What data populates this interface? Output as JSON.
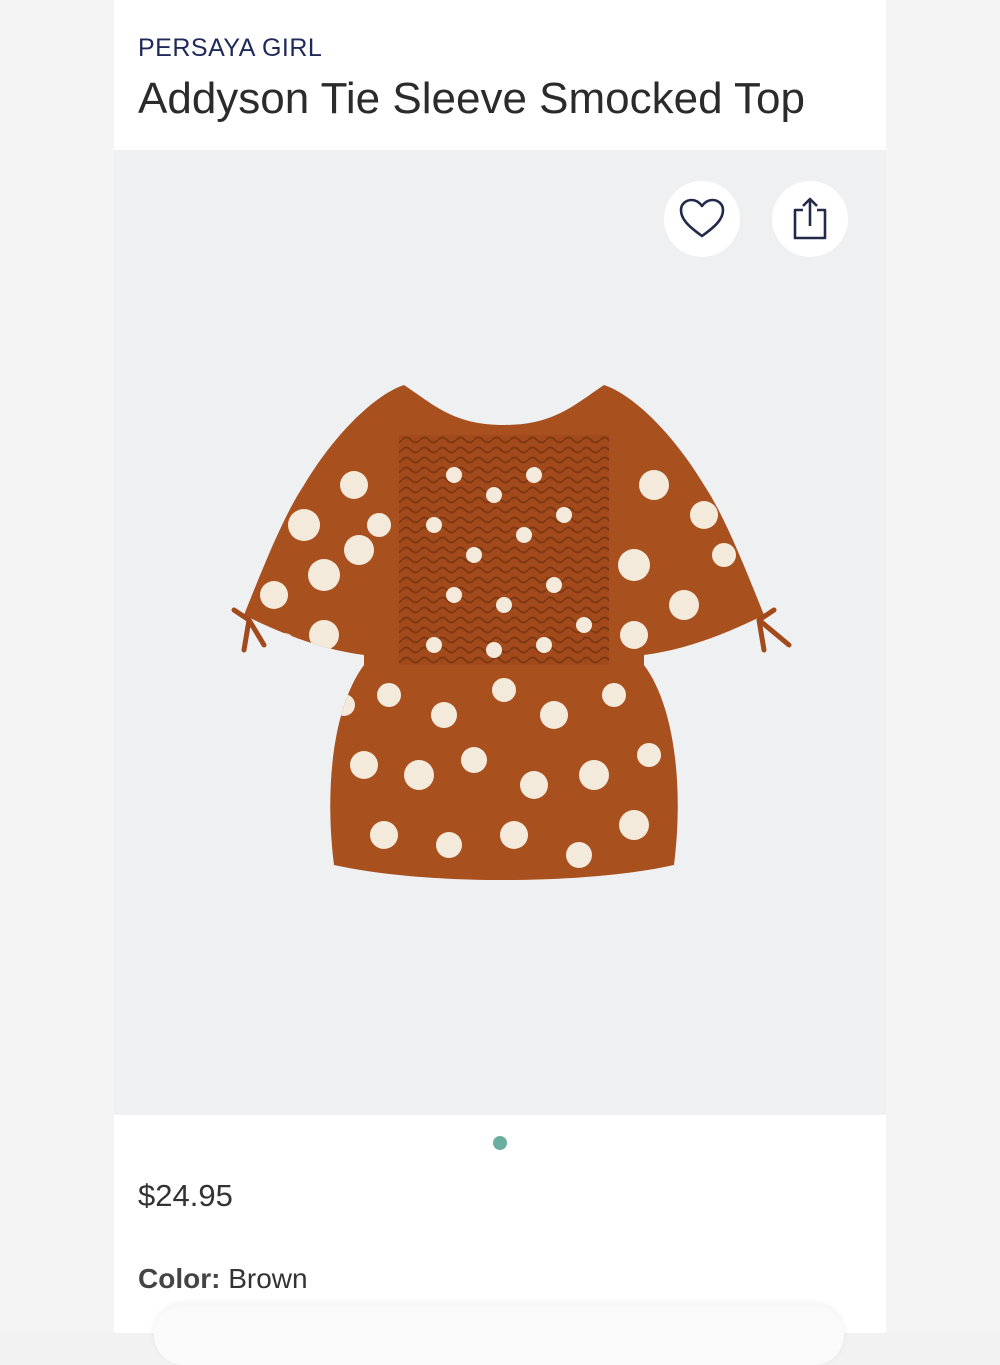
{
  "product": {
    "brand": "PERSAYA GIRL",
    "title": "Addyson Tie Sleeve Smocked Top",
    "price": "$24.95",
    "color_label": "Color:",
    "color_value": "Brown"
  },
  "image": {
    "carousel_active_index": 1,
    "carousel_total": 1,
    "fabric_color": "#a9501f",
    "dot_color": "#f3eadc"
  },
  "icons": {
    "favorite": "heart-icon",
    "share": "share-icon"
  }
}
